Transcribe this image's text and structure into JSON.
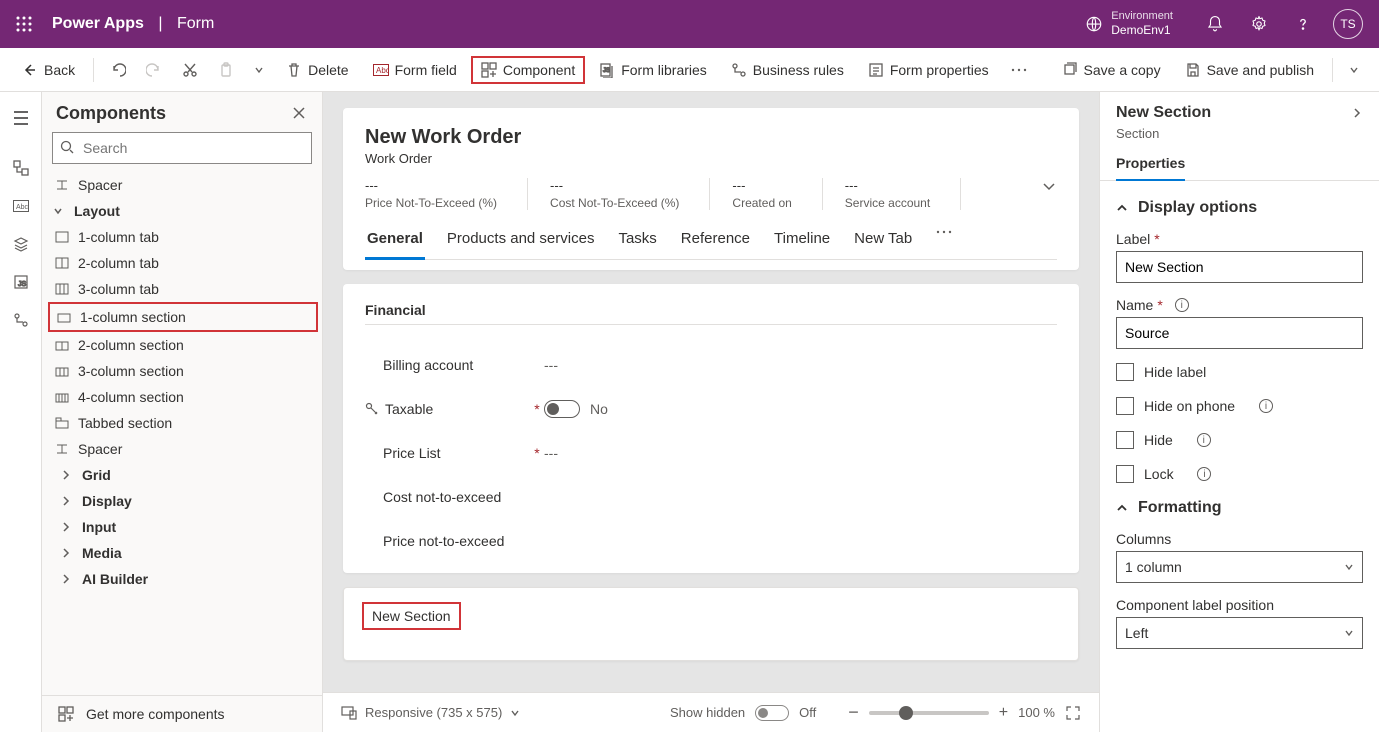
{
  "header": {
    "brand": "Power Apps",
    "page": "Form",
    "env_label": "Environment",
    "env_name": "DemoEnv1",
    "avatar_initials": "TS"
  },
  "toolbar": {
    "back": "Back",
    "delete": "Delete",
    "form_field": "Form field",
    "component": "Component",
    "form_libraries": "Form libraries",
    "business_rules": "Business rules",
    "form_properties": "Form properties",
    "save_copy": "Save a copy",
    "save_publish": "Save and publish"
  },
  "sidebar": {
    "title": "Components",
    "search_placeholder": "Search",
    "get_more": "Get more components",
    "items": {
      "spacer1": "Spacer",
      "layout": "Layout",
      "col1tab": "1-column tab",
      "col2tab": "2-column tab",
      "col3tab": "3-column tab",
      "col1sec": "1-column section",
      "col2sec": "2-column section",
      "col3sec": "3-column section",
      "col4sec": "4-column section",
      "tabbed": "Tabbed section",
      "spacer2": "Spacer",
      "grid": "Grid",
      "display": "Display",
      "input": "Input",
      "media": "Media",
      "aibuilder": "AI Builder"
    }
  },
  "form": {
    "title": "New Work Order",
    "entity": "Work Order",
    "placeholder": "---",
    "header_fields": [
      {
        "label": "Price Not-To-Exceed (%)"
      },
      {
        "label": "Cost Not-To-Exceed (%)"
      },
      {
        "label": "Created on"
      },
      {
        "label": "Service account"
      }
    ],
    "tabs": [
      "General",
      "Products and services",
      "Tasks",
      "Reference",
      "Timeline",
      "New Tab"
    ],
    "section_financial": "Financial",
    "fields": {
      "billing_account": "Billing account",
      "taxable": "Taxable",
      "taxable_value": "No",
      "price_list": "Price List",
      "cost_nte": "Cost not-to-exceed",
      "price_nte": "Price not-to-exceed"
    },
    "new_section": "New Section"
  },
  "footer": {
    "responsive": "Responsive (735 x 575)",
    "show_hidden": "Show hidden",
    "off": "Off",
    "zoom": "100 %"
  },
  "props": {
    "title": "New Section",
    "subtitle": "Section",
    "tab_properties": "Properties",
    "group_display": "Display options",
    "label_label": "Label",
    "label_value": "New Section",
    "name_label": "Name",
    "name_value": "Source",
    "hide_label": "Hide label",
    "hide_phone": "Hide on phone",
    "hide": "Hide",
    "lock": "Lock",
    "group_formatting": "Formatting",
    "columns_label": "Columns",
    "columns_value": "1 column",
    "clp_label": "Component label position",
    "clp_value": "Left"
  }
}
